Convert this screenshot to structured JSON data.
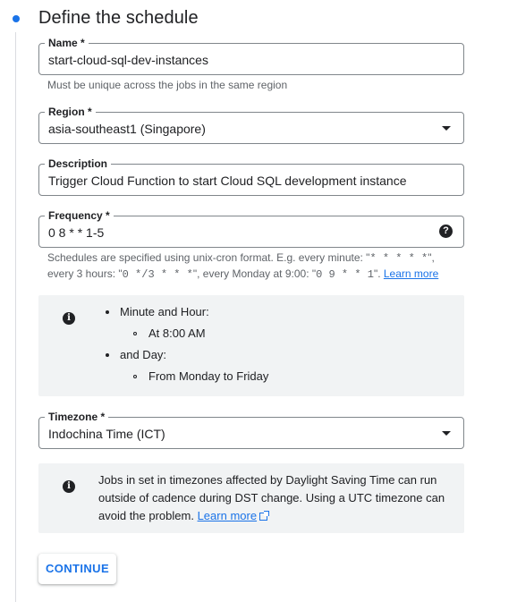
{
  "step": {
    "title": "Define the schedule"
  },
  "name_field": {
    "label": "Name *",
    "value": "start-cloud-sql-dev-instances",
    "hint": "Must be unique across the jobs in the same region"
  },
  "region_field": {
    "label": "Region *",
    "value": "asia-southeast1 (Singapore)"
  },
  "description_field": {
    "label": "Description",
    "value": "Trigger Cloud Function to start Cloud SQL development instance"
  },
  "frequency_field": {
    "label": "Frequency *",
    "value": "0 8 * * 1-5",
    "help_icon": "help-circle-icon",
    "hint_line1_text": "Schedules are specified using unix-cron format. E.g. every minute: \"",
    "hint_line1_code": "* * * * *",
    "hint_line1_end": "\",",
    "hint_line2_a": "every 3 hours: \"",
    "hint_line2_code_a": "0 */3 * * *",
    "hint_line2_b": "\", every Monday at 9:00: \"",
    "hint_line2_code_b": "0 9 * * 1",
    "hint_line2_c": "\". ",
    "learn_more": "Learn more"
  },
  "schedule_summary": {
    "icon": "info-icon",
    "item1": "Minute and Hour:",
    "item1_sub": "At 8:00 AM",
    "item2": "and Day:",
    "item2_sub": "From Monday to Friday"
  },
  "timezone_field": {
    "label": "Timezone *",
    "value": "Indochina Time (ICT)"
  },
  "dst_notice": {
    "icon": "info-icon",
    "line1": "Jobs in set in timezones affected by Daylight Saving Time can run",
    "line2": "outside of cadence during DST change. Using a UTC timezone can",
    "line3": "avoid the problem. ",
    "learn_more": "Learn more",
    "link_icon": "open-in-new-icon"
  },
  "actions": {
    "continue_label": "CONTINUE"
  },
  "colors": {
    "accent": "#1a73e8",
    "outline": "#80868b",
    "info_bg": "#f1f3f4",
    "hint_text": "#5f6368"
  }
}
